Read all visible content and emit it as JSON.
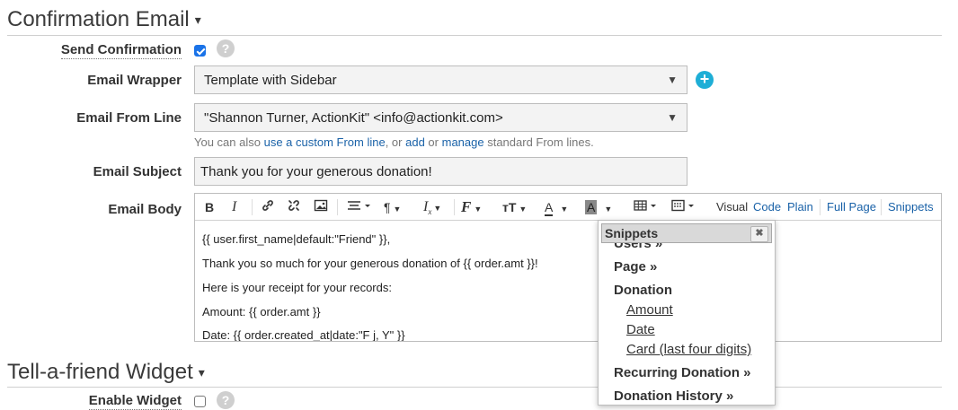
{
  "sections": {
    "confirmation_title": "Confirmation Email",
    "taf_title": "Tell-a-friend Widget",
    "caret": "▾"
  },
  "fields": {
    "send_confirmation": {
      "label": "Send Confirmation",
      "checked": true
    },
    "email_wrapper": {
      "label": "Email Wrapper",
      "value": "Template with Sidebar"
    },
    "email_from": {
      "label": "Email From Line",
      "value": "\"Shannon Turner, ActionKit\" <info@actionkit.com>",
      "help_prefix": "You can also ",
      "help_link1": "use a custom From line",
      "help_mid1": ", or ",
      "help_link2": "add",
      "help_mid2": " or ",
      "help_link3": "manage",
      "help_suffix": " standard From lines."
    },
    "email_subject": {
      "label": "Email Subject",
      "value": "Thank you for your generous donation!"
    },
    "email_body": {
      "label": "Email Body"
    },
    "enable_widget": {
      "label": "Enable Widget",
      "checked": false
    }
  },
  "help_icon_text": "?",
  "plus_icon_text": "+",
  "toolbar": {
    "bold": "B",
    "italic": "I",
    "modes": {
      "visual": "Visual",
      "code": "Code",
      "plain": "Plain",
      "full_page": "Full Page",
      "snippets": "Snippets"
    }
  },
  "editor_body": [
    "{{ user.first_name|default:\"Friend\" }},",
    "Thank you so much for your generous donation of  {{ order.amt }}!",
    "Here is your receipt for your records:",
    "Amount: {{ order.amt }}",
    "Date: {{ order.created_at|date:\"F j, Y\" }}"
  ],
  "snippets_popup": {
    "title": "Snippets",
    "close": "✖",
    "partial_item": "Users »",
    "page": "Page »",
    "donation": "Donation",
    "amount": "Amount",
    "date": "Date",
    "card": "Card (last four digits)",
    "recurring": "Recurring Donation »",
    "history": "Donation History »"
  },
  "colors": {
    "accent_blue": "#1a62a8",
    "checkbox_blue": "#1a73e8",
    "plus_teal": "#1eaed6"
  }
}
